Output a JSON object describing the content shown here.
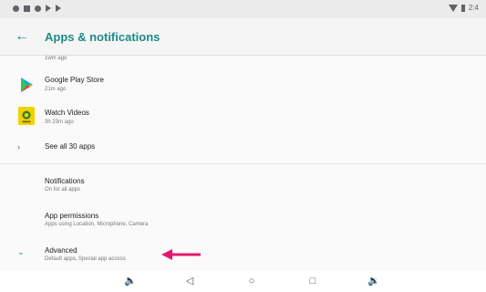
{
  "app_bar": {
    "title": "Apps & notifications"
  },
  "recent_apps": [
    {
      "name": "",
      "time": "1wm ago",
      "icon": "partial-app-icon"
    },
    {
      "name": "Google Play Store",
      "time": "21m ago",
      "icon": "play-store-icon"
    },
    {
      "name": "Watch Videos",
      "time": "3h 23m ago",
      "icon": "watch-videos-icon"
    }
  ],
  "see_all": {
    "label": "See all 30 apps"
  },
  "settings": [
    {
      "title": "Notifications",
      "subtitle": "On for all apps"
    },
    {
      "title": "App permissions",
      "subtitle": "Apps using Location, Microphone, Camera"
    }
  ],
  "advanced": {
    "title": "Advanced",
    "subtitle": "Default apps, Special app access"
  },
  "colors": {
    "accent": "#1e8b84",
    "arrow": "#e5196b"
  },
  "status_bar": {
    "time": "2:4"
  }
}
